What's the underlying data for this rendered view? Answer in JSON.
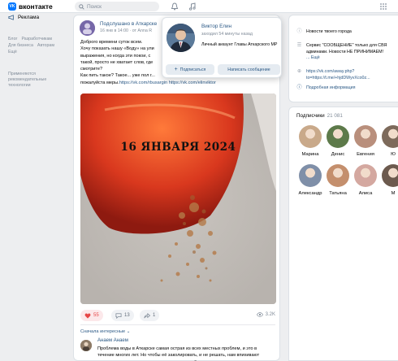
{
  "header": {
    "logo_text": "вконтакте",
    "search_placeholder": "Поиск",
    "icons": [
      "bell-icon",
      "music-icon",
      "apps-grid-icon"
    ]
  },
  "sidebar": {
    "ads_label": "Реклама",
    "footer_links": [
      [
        "Блог",
        "Разработчикам"
      ],
      [
        "Для бизнеса",
        "Авторам"
      ],
      [
        "Ещё"
      ]
    ],
    "tech_note_line1": "Применяются",
    "tech_note_line2": "рекомендательные",
    "tech_note_line3": "технологии"
  },
  "post": {
    "author": "Подслушано в Аткарске",
    "meta": "16 янв в 14:00 · от Anna R",
    "text_lines": [
      "Доброго времени суток всем.",
      "Хочу показать нашу «Воду» на ули",
      "выражения, но когда эти покои, с",
      "такой, просто не хватает слов, где",
      "смотрите?",
      "Как пить такое? Такое... уже пол г...",
      "пожалуйста меры."
    ],
    "links": [
      "https://vk.com/rbusargin",
      "https://vk.com/elinviktor"
    ],
    "image_caption": "16 ЯНВАРЯ 2024",
    "likes": "55",
    "comments": "13",
    "shares": "1",
    "views": "3.2K",
    "sort_label": "Сначала интересные",
    "comment": {
      "author": "Анаем Анаем",
      "text": "Проблема воды в Аткарске самая острая из всех местных проблем, и это в течение многих лет. Но чтобы её заколировать, и не решать, нам впихивают разные показушные проекты типа пешеходной зоны, спортплощадок и разноцветных китайских лампочек в парке."
    }
  },
  "popup": {
    "name": "Виктор Елин",
    "last_seen": "заходил 54 минуты назад",
    "description": "Личный аккаунт Главы Аткарского МР",
    "subscribe_label": "Подписаться",
    "message_label": "Написать сообщение"
  },
  "info": {
    "status": "Новости твоего города",
    "notice_line1": "Сервис \"СООБЩЕНИЕ\" только для СВЯ",
    "notice_line2": "админами. Новости НЕ ПРИНИМАЕМ!",
    "notice_line3": "... Ещё",
    "link_line1": "https://vk.com/away.php?",
    "link_line2": "to=https://t.me/+hjdDWyvXco0z...",
    "more_label": "Подробная информация"
  },
  "subscribers": {
    "title": "Подписчики",
    "count": "21 081",
    "people": [
      {
        "name": "Марина",
        "color": "#c9a98a"
      },
      {
        "name": "Денис",
        "color": "#5d7a4a"
      },
      {
        "name": "Евгения",
        "color": "#b98f7c"
      },
      {
        "name": "Ю",
        "color": "#7d6a5b"
      },
      {
        "name": "Александр",
        "color": "#7f8fa8"
      },
      {
        "name": "Татьяна",
        "color": "#c48f6d"
      },
      {
        "name": "Алиса",
        "color": "#d4a8a0"
      },
      {
        "name": "М",
        "color": "#6c5a4e"
      }
    ]
  }
}
